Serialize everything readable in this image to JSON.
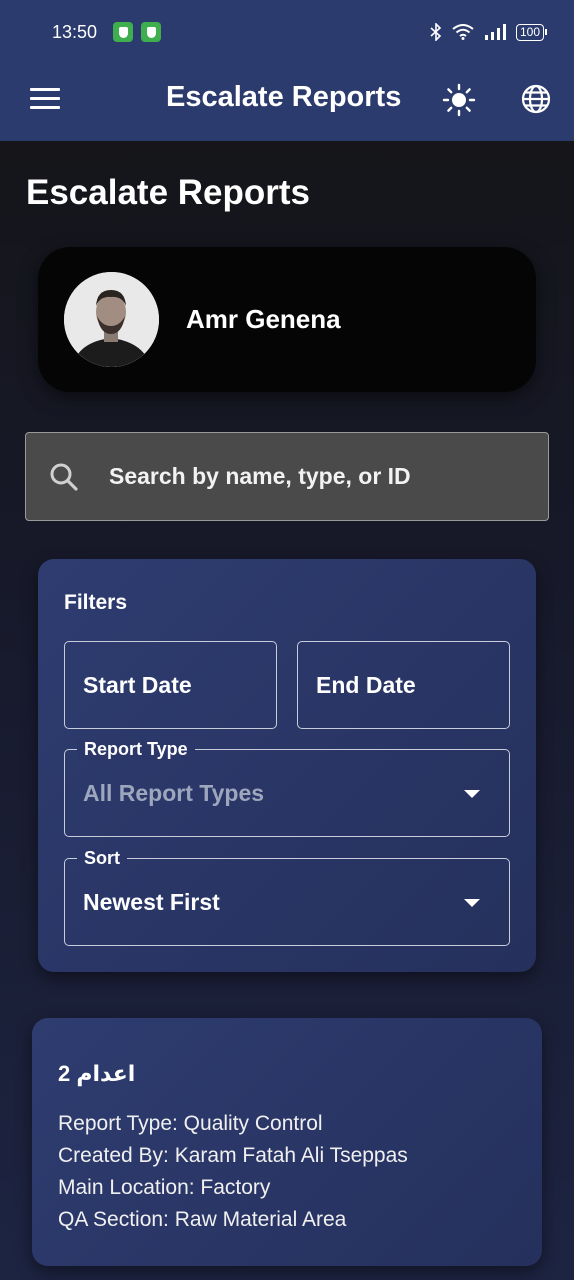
{
  "status_bar": {
    "time": "13:50",
    "battery": "100"
  },
  "app_bar": {
    "title": "Escalate Reports",
    "icons": [
      "menu-icon",
      "sun-icon",
      "globe-icon"
    ]
  },
  "page": {
    "title": "Escalate Reports"
  },
  "profile": {
    "name": "Amr Genena"
  },
  "search": {
    "placeholder": "Search by name, type, or ID"
  },
  "filters": {
    "title": "Filters",
    "start_date_label": "Start Date",
    "end_date_label": "End Date",
    "report_type": {
      "label": "Report Type",
      "value": "All Report Types"
    },
    "sort": {
      "label": "Sort",
      "value": "Newest First"
    }
  },
  "reports": [
    {
      "title": "اعدام 2",
      "report_type": "Report Type: Quality Control",
      "created_by": "Created By: Karam Fatah Ali Tseppas",
      "main_location": "Main Location: Factory",
      "qa_section": "QA Section: Raw Material Area"
    }
  ],
  "colors": {
    "app_bar": "#2c3b6d",
    "card": "#2e3c70",
    "profile_card": "#050505",
    "search_bg": "#4a4a4a",
    "status_icon_green": "#3fae4e"
  }
}
